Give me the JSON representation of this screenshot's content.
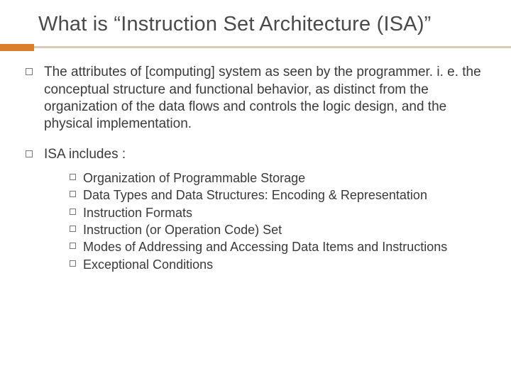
{
  "title": "What is “Instruction Set Architecture (ISA)”",
  "bullets": [
    {
      "text": "The attributes of [computing] system as seen by the programmer. i. e. the conceptual structure and functional behavior, as distinct from the organization of the data flows and controls the logic design, and the physical implementation."
    },
    {
      "text": "ISA includes :",
      "sub": [
        "Organization of Programmable Storage",
        "Data Types and Data Structures: Encoding & Representation",
        "Instruction Formats",
        "Instruction (or Operation Code) Set",
        "Modes of Addressing and Accessing Data Items and Instructions",
        "Exceptional Conditions"
      ]
    }
  ]
}
